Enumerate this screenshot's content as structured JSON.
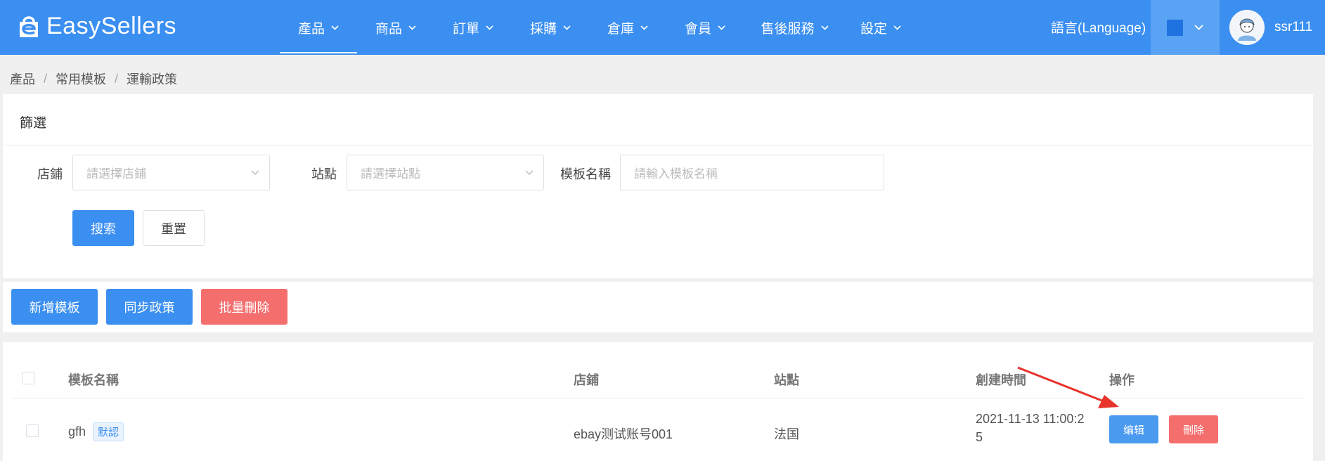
{
  "header": {
    "logo_text": "EasySellers",
    "nav": [
      {
        "label": "產品",
        "active": true
      },
      {
        "label": "商品",
        "active": false
      },
      {
        "label": "訂單",
        "active": false
      },
      {
        "label": "採購",
        "active": false
      },
      {
        "label": "倉庫",
        "active": false
      },
      {
        "label": "會員",
        "active": false
      },
      {
        "label": "售後服務",
        "active": false
      },
      {
        "label": "設定",
        "active": false
      }
    ],
    "language_label": "語言(Language)",
    "theme_color": "#1e73e0",
    "username": "ssr111"
  },
  "breadcrumb": [
    "產品",
    "常用模板",
    "運輸政策"
  ],
  "filter": {
    "title": "篩選",
    "store_label": "店鋪",
    "store_placeholder": "請選擇店鋪",
    "site_label": "站點",
    "site_placeholder": "請選擇站點",
    "template_label": "模板名稱",
    "template_placeholder": "請輸入模板名稱",
    "search_button": "搜索",
    "reset_button": "重置"
  },
  "toolbar": {
    "add_button": "新增模板",
    "sync_button": "同步政策",
    "bulk_delete_button": "批量刪除"
  },
  "table": {
    "columns": [
      "模板名稱",
      "店鋪",
      "站點",
      "創建時間",
      "操作"
    ],
    "rows": [
      {
        "name": "gfh",
        "tag": "默認",
        "store": "ebay测试账号001",
        "site": "法国",
        "created_line1": "2021-11-13 11:00:2",
        "created_line2": "5",
        "edit_label": "编辑",
        "delete_label": "刪除"
      }
    ]
  },
  "colors": {
    "primary": "#3b8ff0",
    "danger": "#f46e6e",
    "annotation_arrow": "#e8332a"
  }
}
